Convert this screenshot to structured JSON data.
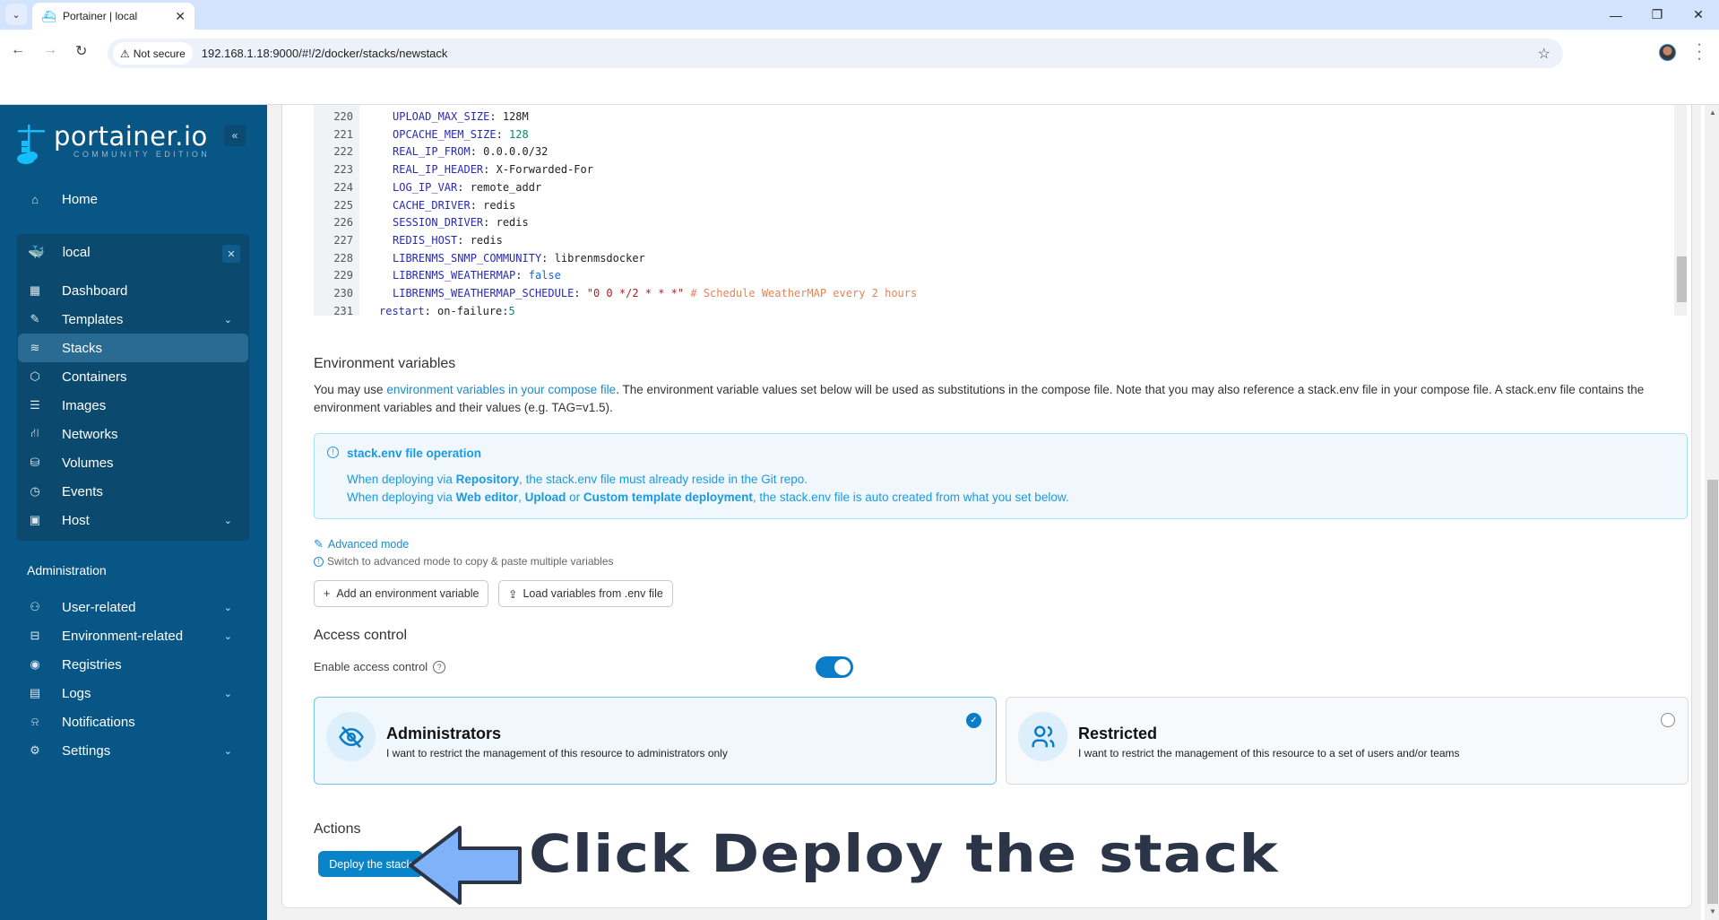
{
  "browser": {
    "tab_title": "Portainer | local",
    "security_label": "Not secure",
    "url": "192.168.1.18:9000/#!/2/docker/stacks/newstack"
  },
  "sidebar": {
    "logo_main": "portainer.io",
    "logo_sub": "COMMUNITY EDITION",
    "home": "Home",
    "environment": {
      "name": "local",
      "items": [
        {
          "label": "Dashboard",
          "icon": "dashboard-icon",
          "has_chevron": false
        },
        {
          "label": "Templates",
          "icon": "edit-icon",
          "has_chevron": true
        },
        {
          "label": "Stacks",
          "icon": "layers-icon",
          "has_chevron": false,
          "active": true
        },
        {
          "label": "Containers",
          "icon": "box-icon",
          "has_chevron": false
        },
        {
          "label": "Images",
          "icon": "list-icon",
          "has_chevron": false
        },
        {
          "label": "Networks",
          "icon": "network-icon",
          "has_chevron": false
        },
        {
          "label": "Volumes",
          "icon": "database-icon",
          "has_chevron": false
        },
        {
          "label": "Events",
          "icon": "clock-icon",
          "has_chevron": false
        },
        {
          "label": "Host",
          "icon": "trello-icon",
          "has_chevron": true
        }
      ]
    },
    "admin_heading": "Administration",
    "admin_items": [
      {
        "label": "User-related",
        "icon": "users-icon",
        "has_chevron": true
      },
      {
        "label": "Environment-related",
        "icon": "hard-drive-icon",
        "has_chevron": true
      },
      {
        "label": "Registries",
        "icon": "radio-icon",
        "has_chevron": false
      },
      {
        "label": "Logs",
        "icon": "file-text-icon",
        "has_chevron": true
      },
      {
        "label": "Notifications",
        "icon": "bell-icon",
        "has_chevron": false
      },
      {
        "label": "Settings",
        "icon": "settings-icon",
        "has_chevron": true
      }
    ]
  },
  "editor": {
    "lines": [
      {
        "n": "220",
        "indent": 6,
        "key": "UPLOAD_MAX_SIZE",
        "val": "128M",
        "type": "plain"
      },
      {
        "n": "221",
        "indent": 6,
        "key": "OPCACHE_MEM_SIZE",
        "val": "128",
        "type": "num"
      },
      {
        "n": "222",
        "indent": 6,
        "key": "REAL_IP_FROM",
        "val": "0.0.0.0/32",
        "type": "plain"
      },
      {
        "n": "223",
        "indent": 6,
        "key": "REAL_IP_HEADER",
        "val": "X-Forwarded-For",
        "type": "plain"
      },
      {
        "n": "224",
        "indent": 6,
        "key": "LOG_IP_VAR",
        "val": "remote_addr",
        "type": "plain"
      },
      {
        "n": "225",
        "indent": 6,
        "key": "CACHE_DRIVER",
        "val": "redis",
        "type": "plain"
      },
      {
        "n": "226",
        "indent": 6,
        "key": "SESSION_DRIVER",
        "val": "redis",
        "type": "plain"
      },
      {
        "n": "227",
        "indent": 6,
        "key": "REDIS_HOST",
        "val": "redis",
        "type": "plain"
      },
      {
        "n": "228",
        "indent": 6,
        "key": "LIBRENMS_SNMP_COMMUNITY",
        "val": "librenmsdocker",
        "type": "plain"
      },
      {
        "n": "229",
        "indent": 6,
        "key": "LIBRENMS_WEATHERMAP",
        "val": "false",
        "type": "bool"
      },
      {
        "n": "230",
        "indent": 6,
        "key": "LIBRENMS_WEATHERMAP_SCHEDULE",
        "val": "\"0 0 */2 * * *\"",
        "type": "str",
        "comment": "# Schedule WeatherMAP every 2 hours"
      },
      {
        "n": "231",
        "indent": 4,
        "key": "restart",
        "val": "on-failure:",
        "type": "plain",
        "tail": "5"
      }
    ]
  },
  "env_vars": {
    "title": "Environment variables",
    "desc_prefix": "You may use ",
    "desc_link": "environment variables in your compose file",
    "desc_suffix": ". The environment variable values set below will be used as substitutions in the compose file. Note that you may also reference a stack.env file in your compose file. A stack.env file contains the environment variables and their values (e.g. TAG=v1.5).",
    "info_title": "stack.env file operation",
    "info_line1": [
      "When deploying via ",
      "Repository",
      ", the stack.env file must already reside in the Git repo."
    ],
    "info_line2": [
      "When deploying via ",
      "Web editor",
      ", ",
      "Upload",
      " or ",
      "Custom template deployment",
      ", the stack.env file is auto created from what you set below."
    ],
    "advanced_mode": "Advanced mode",
    "advanced_hint": "Switch to advanced mode to copy & paste multiple variables",
    "add_button": "Add an environment variable",
    "load_button": "Load variables from .env file"
  },
  "access_control": {
    "title": "Access control",
    "enable_label": "Enable access control",
    "enabled": true,
    "options": [
      {
        "title": "Administrators",
        "desc": "I want to restrict the management of this resource to administrators only",
        "selected": true
      },
      {
        "title": "Restricted",
        "desc": "I want to restrict the management of this resource to a set of users and/or teams",
        "selected": false
      }
    ]
  },
  "actions": {
    "title": "Actions",
    "deploy_button": "Deploy the stack"
  },
  "annotation": {
    "callout_text": "Click Deploy the stack",
    "arrow_color": "#7fb2f9"
  },
  "colors": {
    "sidebar_bg": "#075685",
    "accent": "#0a84c9",
    "info_text": "#1a9ae0"
  }
}
